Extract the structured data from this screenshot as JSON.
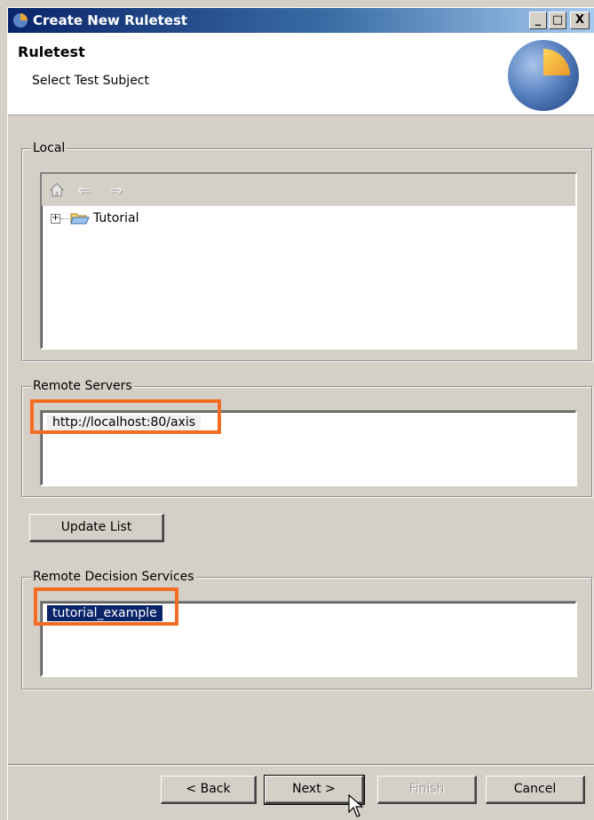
{
  "window": {
    "title": "Create New Ruletest",
    "controls": {
      "minimize": "_",
      "maximize": "□",
      "close": "X"
    }
  },
  "header": {
    "title": "Ruletest",
    "subtitle": "Select Test Subject"
  },
  "local": {
    "label": "Local",
    "toolbar_icons": [
      "home-icon",
      "back-arrow-icon",
      "forward-arrow-icon"
    ],
    "tree": [
      {
        "label": "Tutorial",
        "expander": "+"
      }
    ]
  },
  "remote_servers": {
    "label": "Remote Servers",
    "items": [
      "http://localhost:80/axis"
    ]
  },
  "update_button": {
    "label": "Update List"
  },
  "remote_decision_services": {
    "label": "Remote Decision Services",
    "items": [
      "tutorial_example"
    ]
  },
  "buttons": {
    "back": "< Back",
    "next": "Next >",
    "finish": "Finish",
    "cancel": "Cancel"
  },
  "colors": {
    "highlight": "#f36c21",
    "selection": "#0a246a",
    "titlebar": "#0a246a",
    "dialog_bg": "#d4d0c8"
  }
}
